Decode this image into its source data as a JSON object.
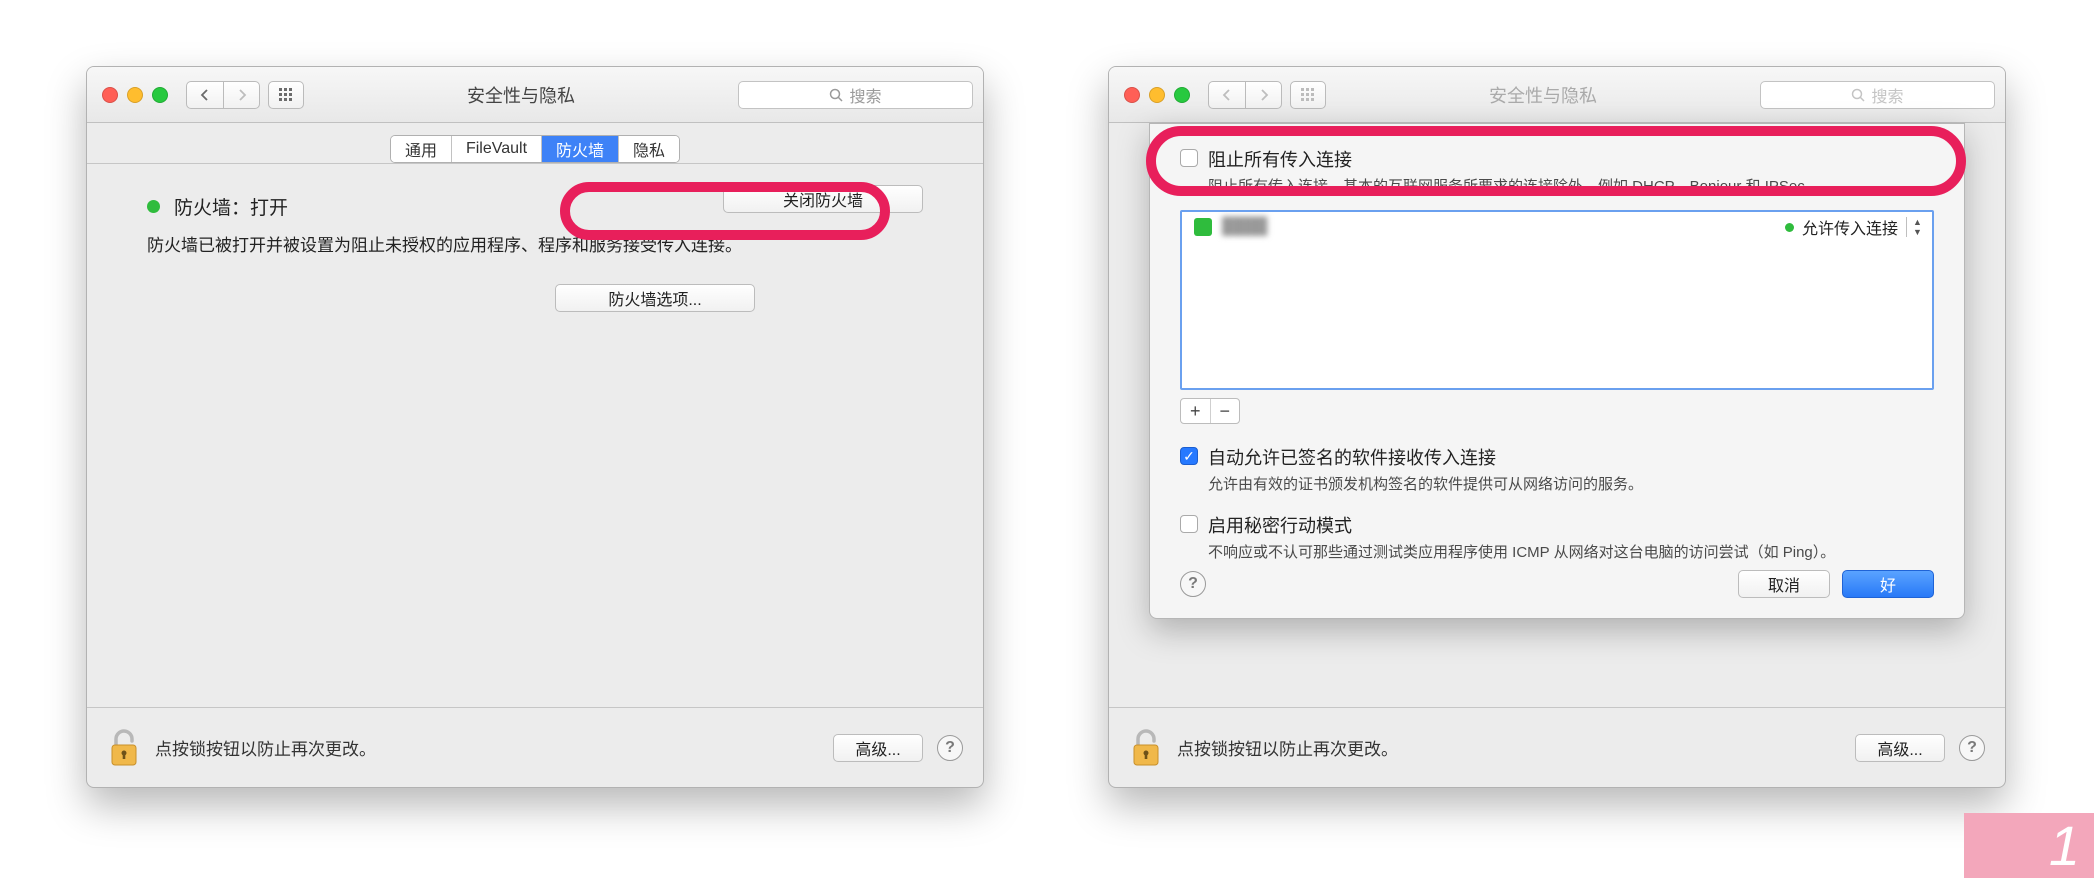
{
  "window_title": "安全性与隐私",
  "search_placeholder": "搜索",
  "tabs": {
    "general": "通用",
    "filevault": "FileVault",
    "firewall": "防火墙",
    "privacy": "隐私"
  },
  "left": {
    "status_label": "防火墙：打开",
    "status_desc": "防火墙已被打开并被设置为阻止未授权的应用程序、程序和服务接受传入连接。",
    "close_btn": "关闭防火墙",
    "options_btn": "防火墙选项..."
  },
  "sheet": {
    "block_all": {
      "label": "阻止所有传入连接",
      "sub": "阻止所有传入连接，基本的互联网服务所要求的连接除外，例如 DHCP、Bonjour 和 IPSec。"
    },
    "app_row": {
      "name": "████",
      "permission": "允许传入连接"
    },
    "auto_allow": {
      "label": "自动允许已签名的软件接收传入连接",
      "sub": "允许由有效的证书颁发机构签名的软件提供可从网络访问的服务。"
    },
    "stealth": {
      "label": "启用秘密行动模式",
      "sub": "不响应或不认可那些通过测试类应用程序使用 ICMP 从网络对这台电脑的访问尝试（如 Ping）。"
    },
    "cancel": "取消",
    "ok": "好"
  },
  "bottom": {
    "lock_text": "点按锁按钮以防止再次更改。",
    "advanced": "高级..."
  },
  "badge": "1"
}
